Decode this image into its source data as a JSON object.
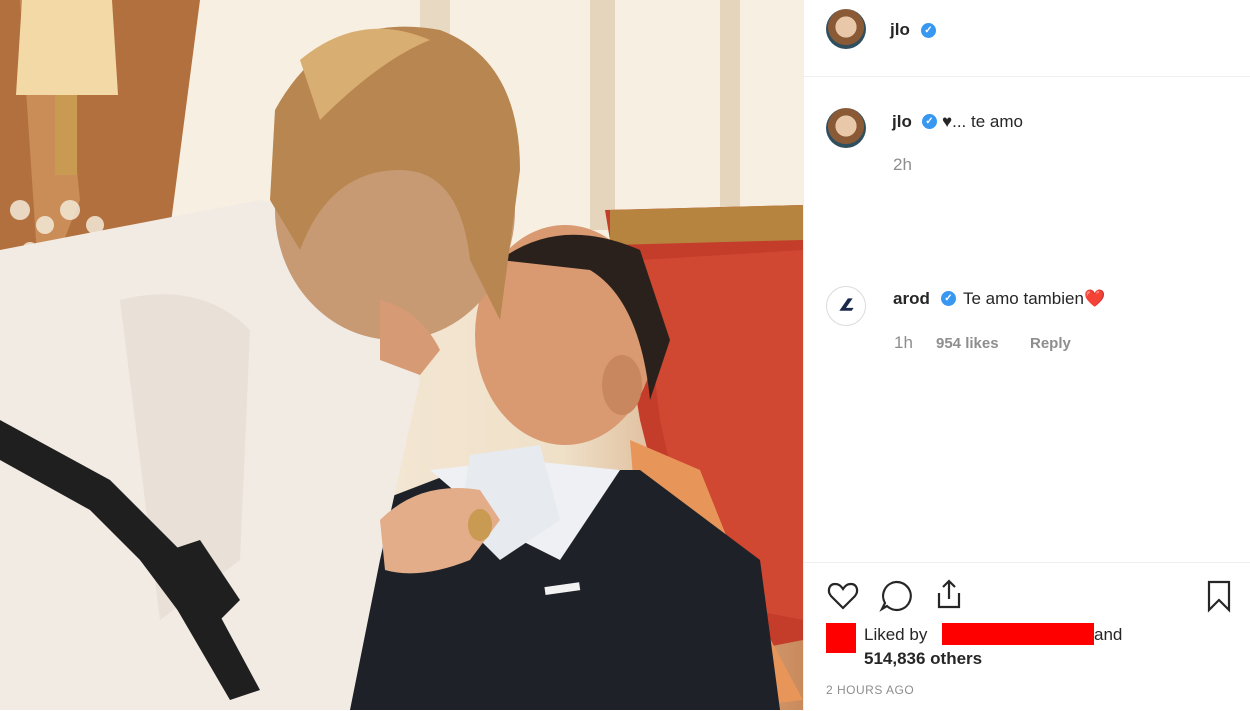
{
  "post": {
    "author": "jlo",
    "caption": {
      "username": "jlo",
      "text": "♥... te amo",
      "age": "2h"
    },
    "comment": {
      "username": "arod",
      "text": "Te amo tambien❤️",
      "age": "1h",
      "likes": "954 likes",
      "reply": "Reply"
    },
    "likes": {
      "prefix": "Liked by",
      "suffix": "and",
      "others": "514,836 others"
    },
    "timestamp": "2 HOURS AGO"
  },
  "colors": {
    "verified": "#3897f0",
    "redaction": "#ff0000",
    "meta": "#8e8e8e"
  },
  "icons": [
    "heart-icon",
    "comment-icon",
    "share-icon",
    "bookmark-icon",
    "verified-badge-icon"
  ]
}
